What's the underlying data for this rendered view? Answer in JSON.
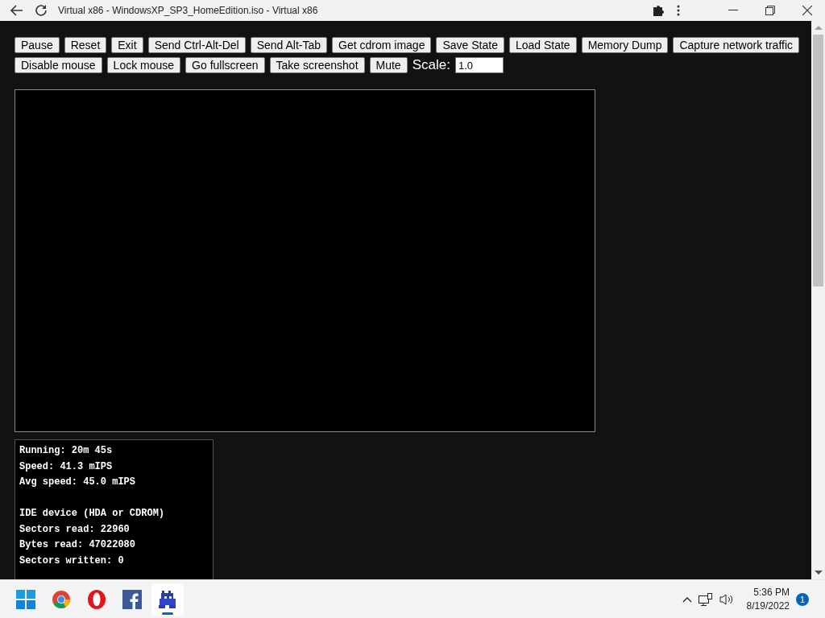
{
  "browser": {
    "title": "Virtual x86 - WindowsXP_SP3_HomeEdition.iso - Virtual x86"
  },
  "toolbar": {
    "buttons": [
      [
        "Pause",
        "Reset",
        "Exit",
        "Send Ctrl-Alt-Del",
        "Send Alt-Tab",
        "Get cdrom image",
        "Save State",
        "Load State",
        "Memory Dump",
        "Capture network traffic"
      ],
      [
        "Disable mouse",
        "Lock mouse",
        "Go fullscreen",
        "Take screenshot",
        "Mute"
      ]
    ],
    "scale_label": "Scale:",
    "scale_value": "1.0"
  },
  "stats": [
    [
      "Running: 20m 45s",
      "Speed: 41.3 mIPS",
      "Avg speed: 45.0 mIPS"
    ],
    [
      "IDE device (HDA or CDROM)",
      "Sectors read: 22960",
      "Bytes read: 47022080",
      "Sectors written: 0"
    ]
  ],
  "taskbar": {
    "apps": [
      {
        "kind": "start",
        "selected": false
      },
      {
        "kind": "chrome",
        "selected": false
      },
      {
        "kind": "opera",
        "selected": false
      },
      {
        "kind": "facebook",
        "selected": false
      },
      {
        "kind": "emulator",
        "selected": true
      }
    ],
    "time": "5:36 PM",
    "date": "8/19/2022",
    "notification_count": "1"
  }
}
